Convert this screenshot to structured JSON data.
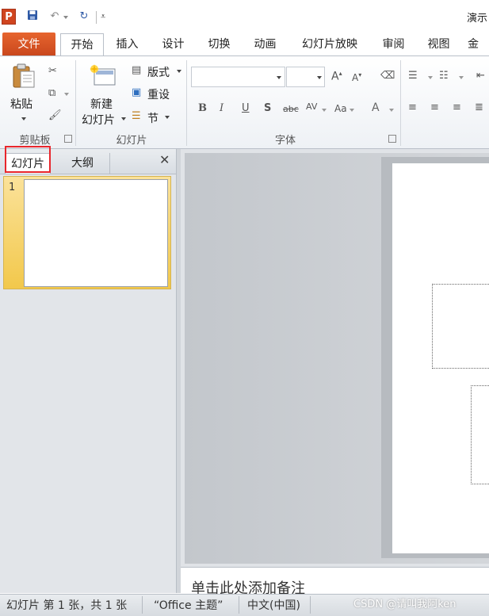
{
  "window": {
    "title": "演示"
  },
  "qat": {
    "app_icon": "P"
  },
  "tabs": {
    "file": "文件",
    "items": [
      "开始",
      "插入",
      "设计",
      "切换",
      "动画",
      "幻灯片放映",
      "审阅",
      "视图",
      "金山"
    ],
    "active_index": 0
  },
  "ribbon": {
    "clipboard": {
      "paste": "粘贴",
      "label": "剪贴板"
    },
    "slides": {
      "new_slide_1": "新建",
      "new_slide_2": "幻灯片",
      "layout": "版式",
      "reset": "重设",
      "section": "节",
      "label": "幻灯片"
    },
    "font": {
      "label": "字体",
      "grow": "A",
      "shrink": "A",
      "bold": "B",
      "italic": "I",
      "underline": "U",
      "shadow": "S",
      "strike": "abc",
      "spacing": "AV",
      "case": "Aa",
      "color": "A"
    },
    "colors": {
      "file_tab": "#d85a23",
      "highlight_box": "#e8262c",
      "thumb_selected": "#f5cf5b"
    }
  },
  "left_panel": {
    "tab_slides": "幻灯片",
    "tab_outline": "大纲",
    "close": "✕",
    "slide_number": "1"
  },
  "notes": {
    "placeholder": "单击此处添加备注"
  },
  "statusbar": {
    "slide_info": "幻灯片 第 1 张，共 1 张",
    "theme": "“Office 主题”",
    "language": "中文(中国)",
    "watermark": "CSDN @请叫我阿ken"
  }
}
